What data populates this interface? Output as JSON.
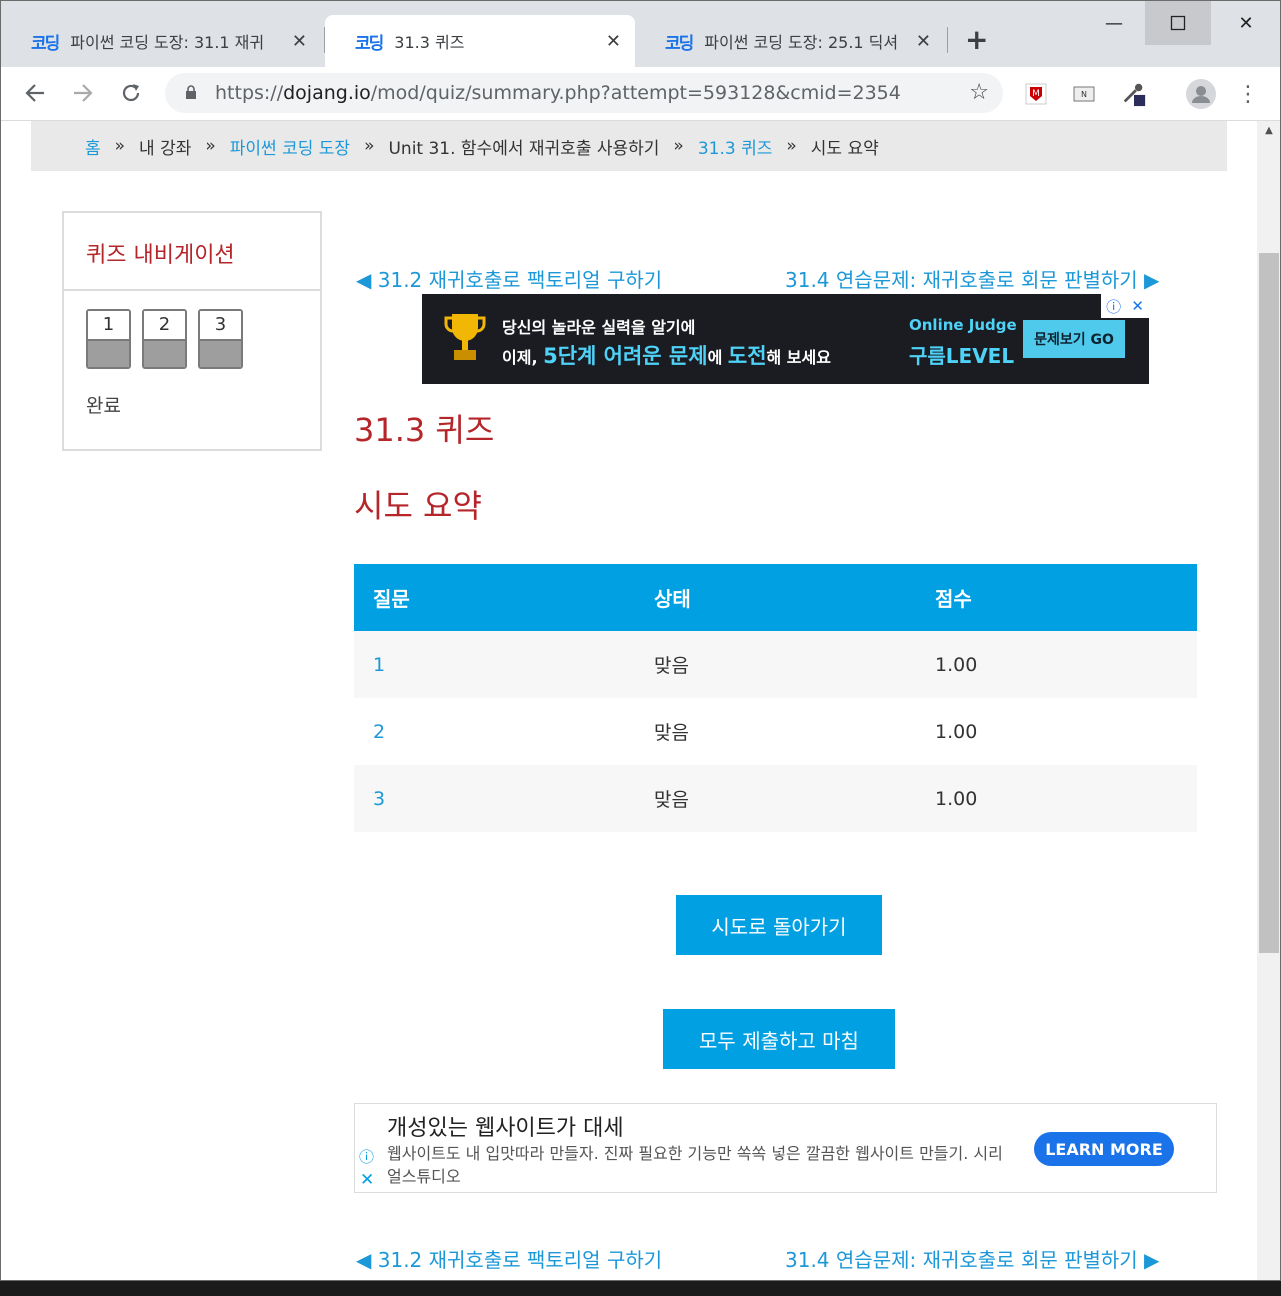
{
  "browser": {
    "tabs": [
      {
        "favicon": "코딩",
        "title": "파이썬 코딩 도장: 31.1 재귀",
        "active": false
      },
      {
        "favicon": "코딩",
        "title": "31.3 퀴즈",
        "active": true
      },
      {
        "favicon": "코딩",
        "title": "파이썬 코딩 도장: 25.1 딕셔",
        "active": false
      }
    ],
    "url_prefix": "https://",
    "url_host": "dojang.io",
    "url_path": "/mod/quiz/summary.php?attempt=593128&cmid=2354"
  },
  "breadcrumb": [
    "홈",
    "내 강좌",
    "파이썬 코딩 도장",
    "Unit 31. 함수에서 재귀호출 사용하기",
    "31.3 퀴즈",
    "시도 요약"
  ],
  "breadcrumb_sep": "»",
  "quiz_nav": {
    "title": "퀴즈 내비게이션",
    "questions": [
      "1",
      "2",
      "3"
    ],
    "finish_label": "완료"
  },
  "page_nav": {
    "prev": "◀ 31.2 재귀호출로 팩토리얼 구하기",
    "next": "31.4 연습문제: 재귀호출로 회문 판별하기 ▶"
  },
  "ad_banner": {
    "line1": "당신의 놀라운 실력을 알기에",
    "line2_a": "이제, ",
    "line2_hl1": "5단계 어려운 문제",
    "line2_b": "에 ",
    "line2_hl2": "도전",
    "line2_c": "해 보세요",
    "brand1": "Online Judge",
    "brand2": "구름LEVEL",
    "cta": "문제보기 GO"
  },
  "heading": "31.3 퀴즈",
  "subheading": "시도 요약",
  "table": {
    "headers": [
      "질문",
      "상태",
      "점수"
    ],
    "rows": [
      {
        "q": "1",
        "status": "맞음",
        "score": "1.00"
      },
      {
        "q": "2",
        "status": "맞음",
        "score": "1.00"
      },
      {
        "q": "3",
        "status": "맞음",
        "score": "1.00"
      }
    ]
  },
  "buttons": {
    "return": "시도로 돌아가기",
    "submit": "모두 제출하고 마침"
  },
  "ad_text": {
    "title": "개성있는 웹사이트가 대세",
    "desc": "웹사이트도 내 입맛따라 만들자. 진짜 필요한 기능만 쏙쏙 넣은 깔끔한 웹사이트 만들기. 시리얼스튜디오",
    "cta": "LEARN MORE"
  },
  "colors": {
    "accent": "#00a0e3",
    "link": "#1c98d8",
    "heading": "#b5262a"
  }
}
